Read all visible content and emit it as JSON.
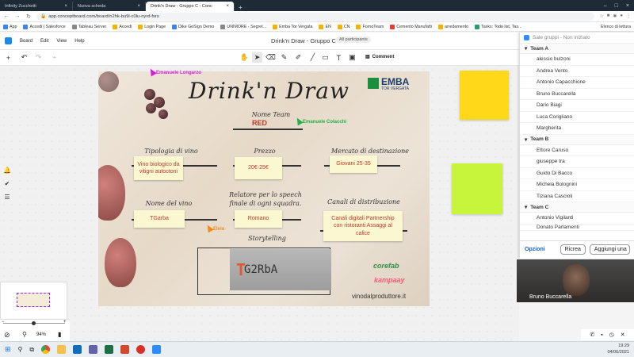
{
  "browser": {
    "tabs": [
      {
        "label": "Infinity Zucchetti",
        "active": false
      },
      {
        "label": "Nuova scheda",
        "active": false
      },
      {
        "label": "Drink'n Draw - Gruppo C - Conc",
        "active": true
      }
    ],
    "url": "app.conceptboard.com/board/n2hk-bu9i-c0lu-nyrd-fsrs",
    "bookmarks": [
      "App",
      "Accedi | Salesforce",
      "Tableau Server",
      "Accedi",
      "Login Page",
      "Dike GoSign Demo",
      "UNIMORE - Segret...",
      "Emba Tor Vergata",
      "EN",
      "CN",
      "FornoTeam",
      "Cemento Manufatti",
      "arredamento",
      "Tasks: Todo list, Tas..."
    ],
    "reading_list": "Elenco di lettura"
  },
  "app": {
    "menu": [
      "Board",
      "Edit",
      "View",
      "Help"
    ],
    "doc_title": "Drink'n Draw - Gruppo C",
    "participants": "All participants",
    "comment_label": "Comment"
  },
  "board": {
    "title": "Drink'n Draw",
    "logo_text": "EMBA",
    "logo_sub": "TOR VERGATA",
    "team_label": "Nome Team",
    "team_value": "RED",
    "tipologia_label": "Tipologia di vino",
    "tipologia_value": "Vino biologico da vitigni autoctoni",
    "prezzo_label": "Prezzo",
    "prezzo_value": "20€-25€",
    "mercato_label": "Mercato di destinazione",
    "mercato_value": "Giovani 25-35",
    "nome_vino_label": "Nome del vino",
    "nome_vino_value": "TGarba",
    "relatore_label": "Relatore per lo speech finale di ogni squadra.",
    "relatore_value": "Romano",
    "canali_label": "Canali di distribuzione",
    "canali_value": "Canali digitali Partnership con ristoranti Assaggi al calice",
    "storytelling_label": "Storytelling",
    "story_t": "T",
    "story_text": "G2RbA",
    "corefab": "corefab",
    "kampaay": "kampaay",
    "vinodalproduttore": "vinodalproduttore.it"
  },
  "cursors": [
    {
      "name": "Emanuele Longarzo",
      "color": "#d81bd8"
    },
    {
      "name": "Emanuele Colacchi",
      "color": "#22b04a"
    },
    {
      "name": "Elvio",
      "color": "#f08a1c"
    }
  ],
  "zoom": {
    "level": "94%"
  },
  "groups": {
    "header": "Sale gruppi - Non iniziato",
    "teams": [
      {
        "name": "Team A",
        "members": [
          "alessio bulzoni",
          "Andrea Vento",
          "Antonio Capacchione",
          "Bruno Buccarella",
          "Dario Biagi",
          "Luca Corigliano",
          "Margherita"
        ]
      },
      {
        "name": "Team B",
        "members": [
          "Ettore Caruso",
          "giuseppe tra",
          "Guido Di Bacco",
          "Michela Bolognini",
          "Tiziana Cascioli"
        ]
      },
      {
        "name": "Team C",
        "members": [
          "Antonio Vigilanti",
          "Donato Parlamenti"
        ]
      }
    ],
    "options_label": "Opzioni",
    "recreate_label": "Ricrea",
    "add_label": "Aggiungi una"
  },
  "video": {
    "name": "Bruno Buccarella"
  },
  "clock": {
    "time": "19:29",
    "date": "04/06/2021"
  },
  "colors": {
    "sticky_yellow": "#ffd81a",
    "sticky_green": "#c6f53c",
    "red_text": "#c0392b"
  }
}
